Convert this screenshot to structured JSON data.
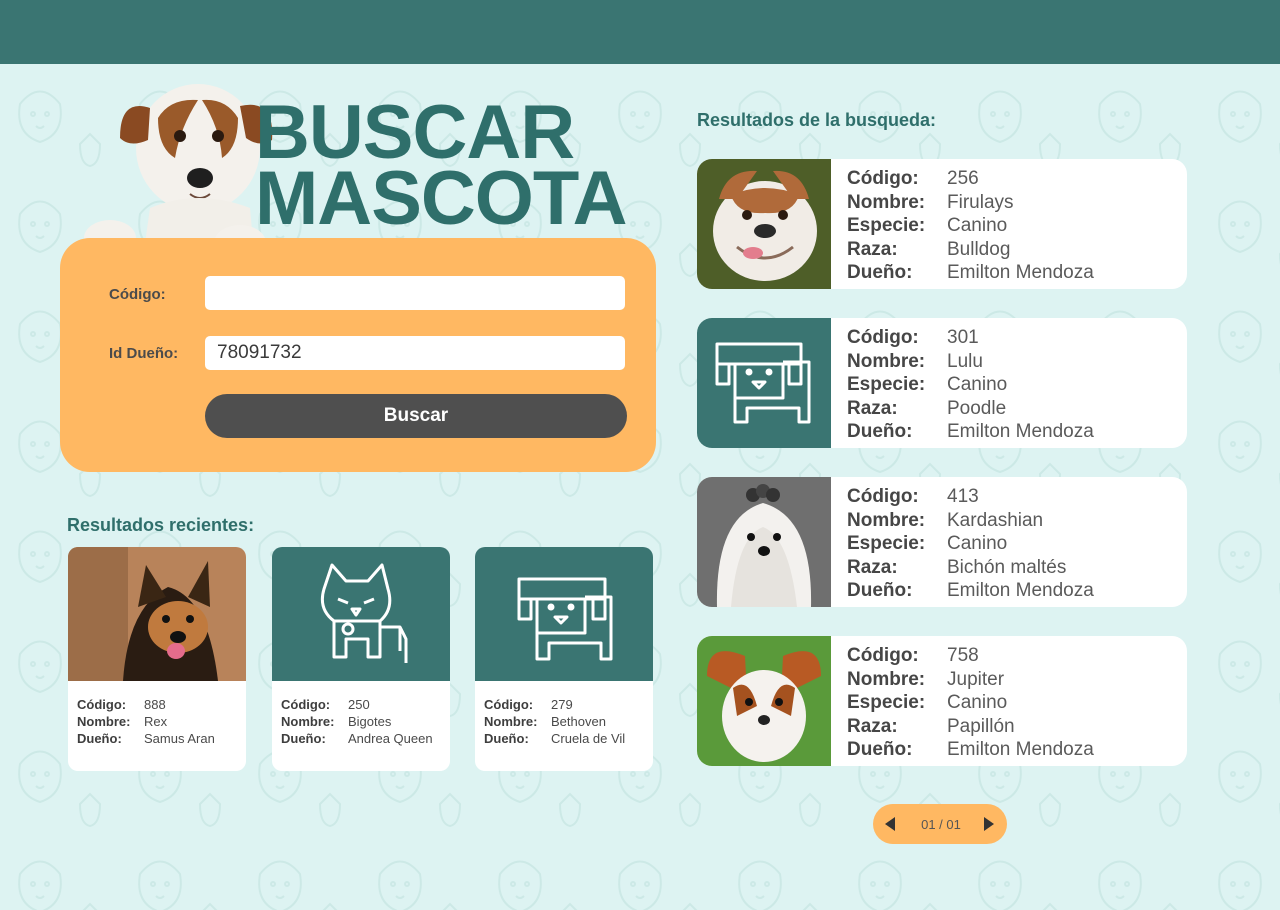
{
  "colors": {
    "accent": "#3a7572",
    "panel": "#ffb862",
    "button": "#4f4f4f",
    "background": "#ddf3f2"
  },
  "hero": {
    "title_line1": "BUSCAR",
    "title_line2": "MASCOTA"
  },
  "search": {
    "codigo_label": "Código:",
    "codigo_value": "",
    "owner_label": "Id Dueño:",
    "owner_value": "78091732",
    "button_label": "Buscar"
  },
  "recent": {
    "title": "Resultados recientes:",
    "items": [
      {
        "icon": "german-shepherd-photo",
        "codigo_label": "Código:",
        "codigo": "888",
        "nombre_label": "Nombre:",
        "nombre": "Rex",
        "dueno_label": "Dueño:",
        "dueno": "Samus Aran"
      },
      {
        "icon": "cat-icon",
        "codigo_label": "Código:",
        "codigo": "250",
        "nombre_label": "Nombre:",
        "nombre": "Bigotes",
        "dueno_label": "Dueño:",
        "dueno": "Andrea Queen"
      },
      {
        "icon": "dog-icon",
        "codigo_label": "Código:",
        "codigo": "279",
        "nombre_label": "Nombre:",
        "nombre": "Bethoven",
        "dueno_label": "Dueño:",
        "dueno": "Cruela de Vil"
      }
    ]
  },
  "results": {
    "title": "Resultados de la busqueda:",
    "labels": {
      "codigo": "Código:",
      "nombre": "Nombre:",
      "especie": "Especie:",
      "raza": "Raza:",
      "dueno": "Dueño:"
    },
    "items": [
      {
        "icon": "bulldog-photo",
        "codigo": "256",
        "nombre": "Firulays",
        "especie": "Canino",
        "raza": "Bulldog",
        "dueno": "Emilton Mendoza"
      },
      {
        "icon": "dog-icon",
        "codigo": "301",
        "nombre": "Lulu",
        "especie": "Canino",
        "raza": "Poodle",
        "dueno": "Emilton Mendoza"
      },
      {
        "icon": "maltese-photo",
        "codigo": "413",
        "nombre": "Kardashian",
        "especie": "Canino",
        "raza": "Bichón maltés",
        "dueno": "Emilton Mendoza"
      },
      {
        "icon": "papillon-photo",
        "codigo": "758",
        "nombre": "Jupiter",
        "especie": "Canino",
        "raza": "Papillón",
        "dueno": "Emilton Mendoza"
      }
    ]
  },
  "pager": {
    "label": "01 / 01",
    "prev_icon": "triangle-left-icon",
    "next_icon": "triangle-right-icon"
  }
}
